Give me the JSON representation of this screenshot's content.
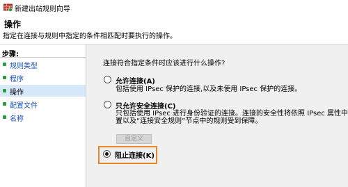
{
  "window": {
    "title": "新建出站规则向导",
    "icon": "firewall-rule-icon"
  },
  "header": {
    "title": "操作",
    "description": "指定在连接与规则中指定的条件相匹配时要执行的操作。"
  },
  "sidebar": {
    "title": "步骤:",
    "items": [
      {
        "label": "规则类型",
        "active": false
      },
      {
        "label": "程序",
        "active": false
      },
      {
        "label": "操作",
        "active": true
      },
      {
        "label": "配置文件",
        "active": false
      },
      {
        "label": "名称",
        "active": false
      }
    ]
  },
  "main": {
    "question": "连接符合指定条件时应该进行什么操作?",
    "options": [
      {
        "label": "允许连接(A)",
        "description": [
          "包括使用 IPsec 保护的连接,以及未使用 IPsec 保护的连接。"
        ],
        "selected": false
      },
      {
        "label": "只允许安全连接(C)",
        "description": [
          "只包括使用 IPsec 进行身份验证的连接。连接的安全性将依照 IPsec 属性中的设",
          "置以及“连接安全规则”节点中的规则受到保障。"
        ],
        "selected": false
      },
      {
        "label": "阻止连接(K)",
        "description": [],
        "selected": true
      }
    ],
    "custom_button": "自定义"
  },
  "colors": {
    "highlight_border": "#e8872b",
    "link": "#1a55b8",
    "bullet": "#2a9b3e",
    "active_step_bg": "#d7e8f9"
  }
}
